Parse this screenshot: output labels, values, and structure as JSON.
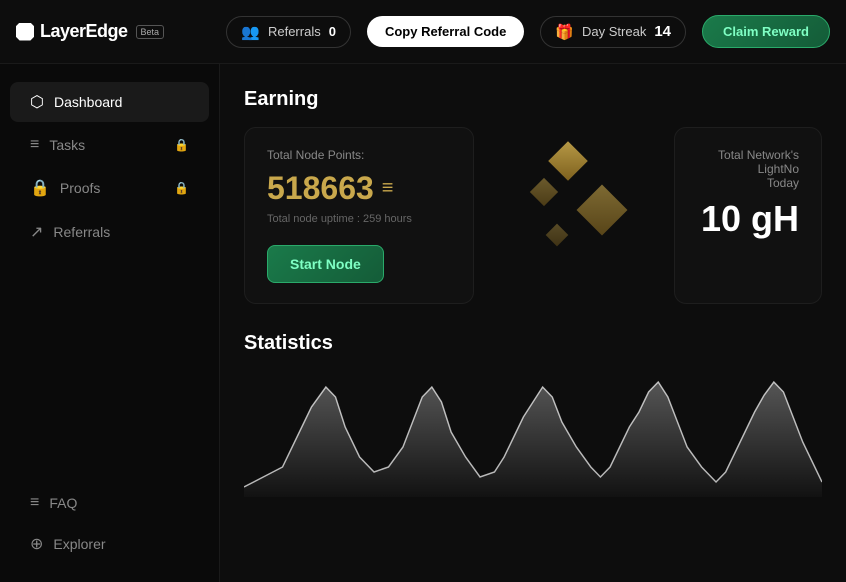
{
  "logo": {
    "text": "LayerEdge",
    "beta": "Beta"
  },
  "header": {
    "referrals_label": "Referrals",
    "referrals_count": "0",
    "copy_btn": "Copy Referral Code",
    "streak_label": "Day Streak",
    "streak_count": "14",
    "claim_btn": "Claim Reward"
  },
  "sidebar": {
    "items": [
      {
        "label": "Dashboard",
        "icon": "⬡",
        "active": true,
        "locked": false
      },
      {
        "label": "Tasks",
        "icon": "≡",
        "active": false,
        "locked": true
      },
      {
        "label": "Proofs",
        "icon": "🔒",
        "active": false,
        "locked": true
      },
      {
        "label": "Referrals",
        "icon": "↗",
        "active": false,
        "locked": false
      }
    ],
    "bottom_items": [
      {
        "label": "FAQ",
        "icon": "≡"
      },
      {
        "label": "Explorer",
        "icon": "⊕"
      }
    ]
  },
  "earning": {
    "title": "Earning",
    "card": {
      "label": "Total Node Points:",
      "points": "518663",
      "uptime_label": "Total node uptime : 259 hours"
    },
    "network": {
      "label": "Total Network's LightNo",
      "sublabel": "Today",
      "value": "10 gH"
    },
    "start_btn": "Start Node"
  },
  "statistics": {
    "title": "Statistics"
  }
}
